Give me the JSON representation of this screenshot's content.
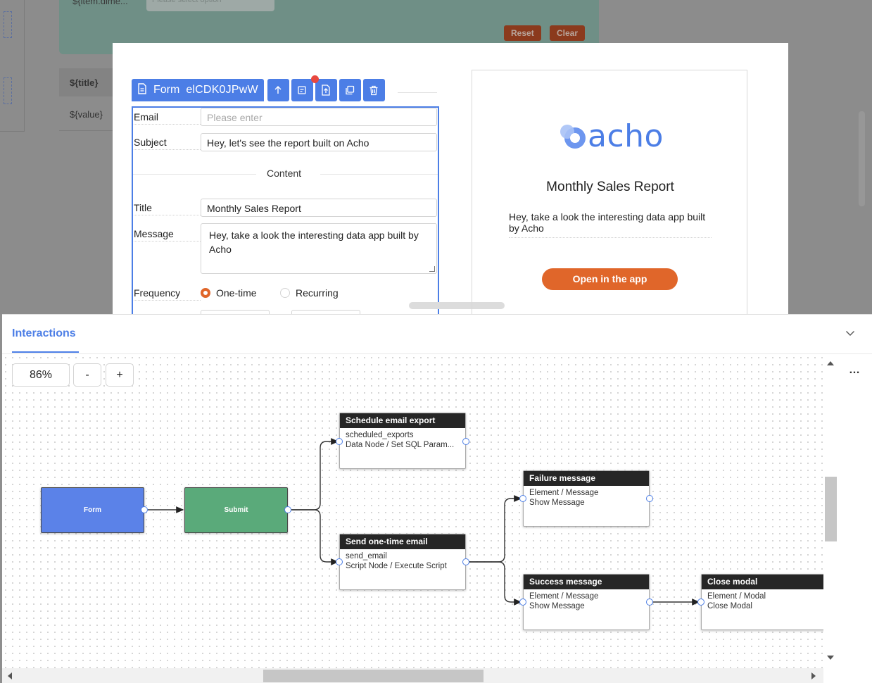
{
  "background": {
    "filter_label": "${item.dime...",
    "filter_placeholder": "Please select option",
    "reset_label": "Reset",
    "clear_label": "Clear",
    "table_header": "${title}",
    "table_cell": "${value}"
  },
  "toolbar": {
    "form_label": "Form",
    "element_id": "elCDK0JPwW",
    "buttons": [
      "move-up-icon",
      "form-settings-icon",
      "export-icon",
      "duplicate-icon",
      "delete-icon"
    ]
  },
  "form": {
    "email_label": "Email",
    "email_placeholder": "Please enter",
    "subject_label": "Subject",
    "subject_value": "Hey, let's see the report built on Acho",
    "content_heading": "Content",
    "title_label": "Title",
    "title_value": "Monthly Sales Report",
    "message_label": "Message",
    "message_value": "Hey, take a look the interesting data app built by Acho",
    "frequency_label": "Frequency",
    "frequency_options": [
      "One-time",
      "Recurring"
    ],
    "frequency_selected": "One-time"
  },
  "preview": {
    "logo_text": "acho",
    "title": "Monthly Sales Report",
    "message": "Hey, take a look the interesting data app built by Acho",
    "button_label": "Open in the app"
  },
  "panel": {
    "tab_label": "Interactions",
    "zoom_level": "86%",
    "zoom_out_label": "-",
    "zoom_in_label": "+",
    "more_label": "…"
  },
  "flow": {
    "nodes": {
      "form": {
        "label": "Form",
        "color": "#5b82e8"
      },
      "submit": {
        "label": "Submit",
        "color": "#5aaa7a"
      },
      "schedule": {
        "title": "Schedule email export",
        "line1": "scheduled_exports",
        "line2": "Data Node / Set SQL Param..."
      },
      "send": {
        "title": "Send one-time email",
        "line1": "send_email",
        "line2": "Script Node / Execute Script"
      },
      "failure": {
        "title": "Failure message",
        "line1": "Element / Message",
        "line2": "Show Message"
      },
      "success": {
        "title": "Success message",
        "line1": "Element / Message",
        "line2": "Show Message"
      },
      "close": {
        "title": "Close modal",
        "line1": "Element / Modal",
        "line2": "Close Modal"
      }
    }
  },
  "colors": {
    "accent": "#4c7ee6",
    "orange": "#e0662a",
    "node_header": "#262626"
  }
}
